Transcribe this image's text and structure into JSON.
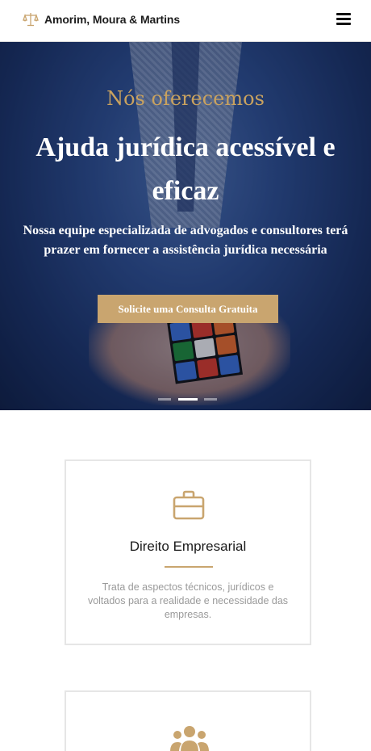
{
  "header": {
    "brand": "Amorim, Moura & Martins",
    "logo_icon": "scales-of-justice-icon",
    "menu_icon": "hamburger-menu-icon"
  },
  "hero": {
    "eyebrow": "Nós oferecemos",
    "headline": "Ajuda jurídica acessível e eficaz",
    "lead": "Nossa equipe especializada de advogados e consultores terá prazer em fornecer a assistência jurídica necessária",
    "cta_label": "Solicite uma Consulta Gratuita",
    "slides": [
      {
        "active": false
      },
      {
        "active": true
      },
      {
        "active": false
      }
    ]
  },
  "services": [
    {
      "icon": "briefcase-icon",
      "title": "Direito Empresarial",
      "description": "Trata de aspectos técnicos, jurídicos e voltados para a realidade e necessidade das empresas."
    },
    {
      "icon": "users-group-icon",
      "title": "",
      "description": ""
    }
  ],
  "colors": {
    "accent": "#c9a56f",
    "eyebrow": "#c9a25f",
    "hero_blue": "#2c4d8e",
    "text_dark": "#1a1a1a",
    "text_muted": "#9a9a9a"
  }
}
